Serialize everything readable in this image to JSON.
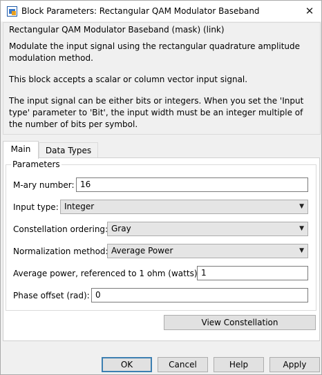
{
  "window": {
    "title": "Block Parameters: Rectangular QAM Modulator Baseband",
    "close_glyph": "✕"
  },
  "description": {
    "title": "Rectangular QAM Modulator Baseband (mask) (link)",
    "paragraphs": [
      "Modulate the input signal using the rectangular quadrature amplitude modulation method.",
      "This block accepts a scalar or column vector input signal.",
      "The input signal can be either bits or integers. When you set the 'Input type' parameter to 'Bit', the input width must be an integer multiple of the number of bits per symbol."
    ]
  },
  "tabs": [
    {
      "label": "Main",
      "active": true
    },
    {
      "label": "Data Types",
      "active": false
    }
  ],
  "parameters": {
    "group_title": "Parameters",
    "mary": {
      "label": "M-ary number:",
      "value": "16"
    },
    "input_type": {
      "label": "Input type:",
      "value": "Integer"
    },
    "constellation_ordering": {
      "label": "Constellation ordering:",
      "value": "Gray"
    },
    "normalization": {
      "label": "Normalization method:",
      "value": "Average Power"
    },
    "avg_power": {
      "label": "Average power, referenced to 1 ohm (watts):",
      "value": "1"
    },
    "phase_offset": {
      "label": "Phase offset (rad):",
      "value": "0"
    },
    "view_constellation_label": "View Constellation"
  },
  "buttons": {
    "ok": "OK",
    "cancel": "Cancel",
    "help": "Help",
    "apply": "Apply"
  },
  "icons": {
    "dropdown_arrow": "▼",
    "app_icon": "simulink-block-icon"
  }
}
